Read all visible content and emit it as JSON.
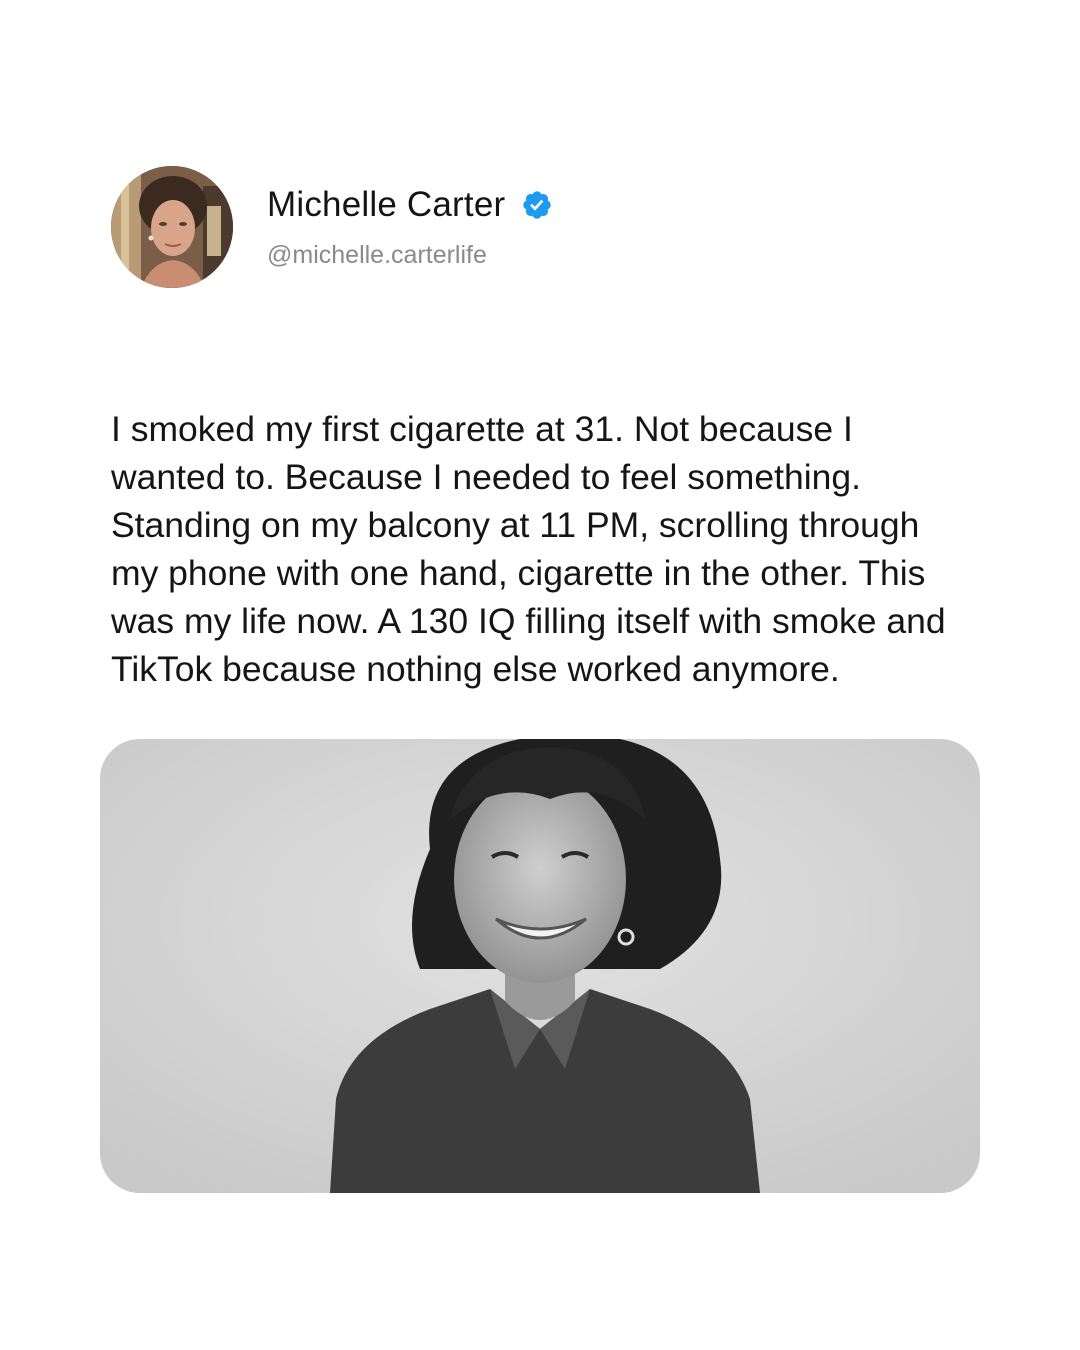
{
  "author": {
    "name": "Michelle Carter",
    "handle": "@michelle.carterlife",
    "verified": true,
    "verified_color": "#1d9bf0",
    "avatar_icon": "avatar-photo"
  },
  "post": {
    "text_lines": [
      "I smoked my first cigarette at 31. Not because I",
      "wanted to. Because I needed to feel something.",
      "Standing on my balcony at 11 PM, scrolling through",
      "my phone with one hand, cigarette in the other. This",
      "was my life now. A 130 IQ filling itself with smoke and",
      "TikTok because nothing else worked anymore."
    ],
    "media": {
      "kind": "black-and-white portrait photo",
      "style": "grayscale"
    }
  },
  "colors": {
    "background": "#ffffff",
    "text": "#151515",
    "handle": "#8a8a8a"
  }
}
